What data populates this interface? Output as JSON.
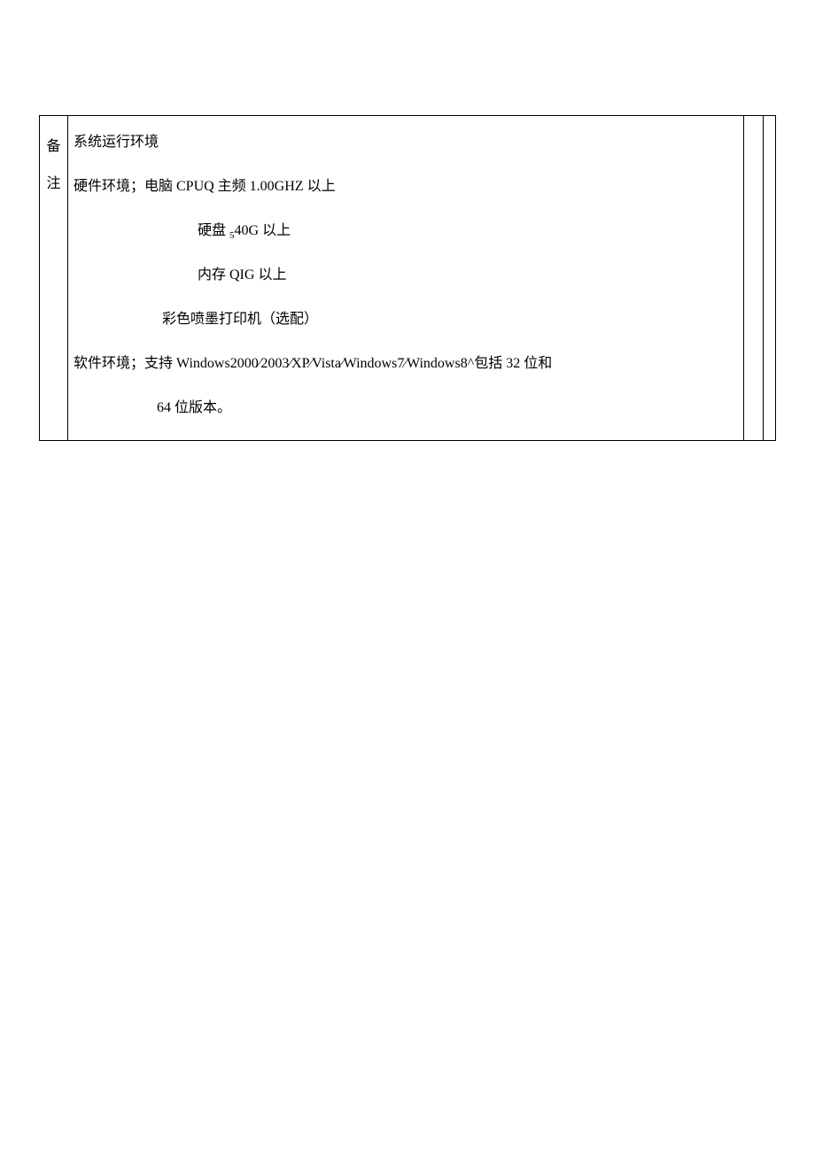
{
  "label": {
    "char1": "备",
    "char2": "注"
  },
  "content": {
    "title": "系统运行环境",
    "hw_line1": "硬件环境；电脑 CPUQ 主频 1.00GHZ 以上",
    "hw_line2_prefix": "硬盘 ",
    "hw_line2_sub": "5",
    "hw_line2_suffix": "40G 以上",
    "hw_line3": "内存 QIG 以上",
    "hw_line4": "彩色喷墨打印机（选配）",
    "sw_line1": "软件环境；支持 Windows2000⁄2003⁄XP⁄Vista⁄Windows7⁄Windows8^包括 32 位和",
    "sw_line2": "64 位版本。"
  }
}
